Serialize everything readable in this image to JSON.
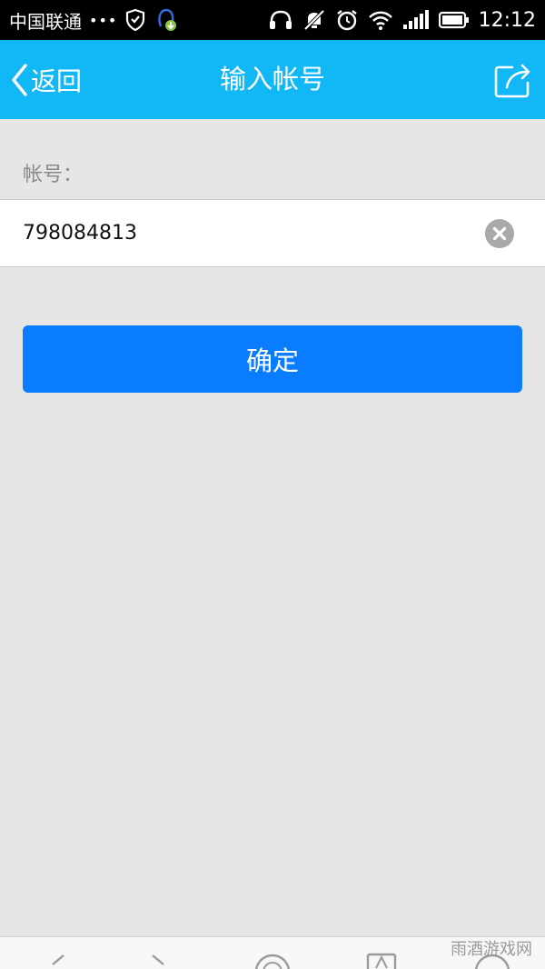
{
  "status_bar": {
    "carrier": "中国联通",
    "dots": "•••",
    "time": "12:12"
  },
  "title_bar": {
    "back_label": "返回",
    "title": "输入帐号"
  },
  "form": {
    "label": "帐号：",
    "value": "798084813"
  },
  "confirm_label": "确定",
  "watermark": "雨酒游戏网",
  "colors": {
    "title_bar": "#12b7f5",
    "confirm_button": "#0a7cff",
    "background": "#e6e6e6"
  }
}
